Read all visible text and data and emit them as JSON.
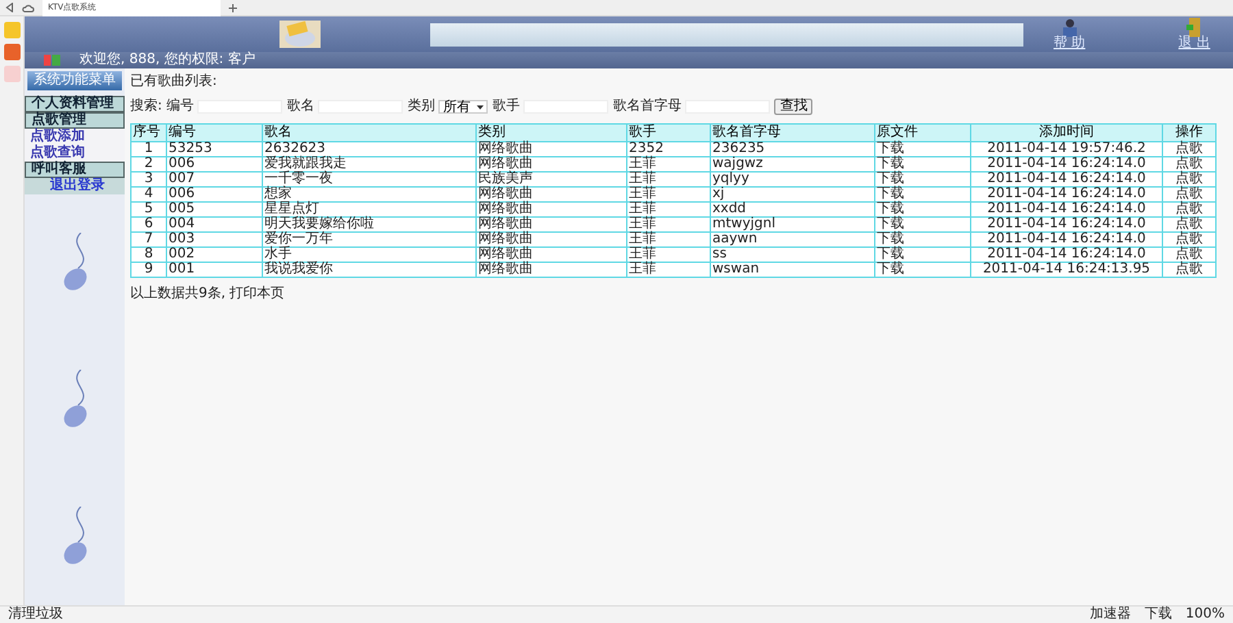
{
  "browser": {
    "tab_title": "KTV点歌系统",
    "status_left": "清理垃圾",
    "status_items": [
      "加速器",
      "下载",
      "100%"
    ]
  },
  "header": {
    "help": "帮 助",
    "exit": "退 出",
    "welcome": "欢迎您, 888, 您的权限: 客户"
  },
  "menu": {
    "title": "系统功能菜单",
    "items": [
      {
        "kind": "section",
        "label": "个人资料管理"
      },
      {
        "kind": "section",
        "label": "点歌管理"
      },
      {
        "kind": "link",
        "label": "点歌添加"
      },
      {
        "kind": "link",
        "label": "点歌查询"
      },
      {
        "kind": "section",
        "label": "呼叫客服"
      },
      {
        "kind": "logout",
        "label": "退出登录"
      }
    ]
  },
  "page_title": "已有歌曲列表:",
  "search": {
    "label": "搜索:",
    "fields": [
      "编号",
      "歌名",
      "类别",
      "歌手",
      "歌名首字母"
    ],
    "category_value": "所有",
    "button": "查找"
  },
  "table": {
    "columns": [
      "序号",
      "编号",
      "歌名",
      "类别",
      "歌手",
      "歌名首字母",
      "原文件",
      "添加时间",
      "操作"
    ],
    "rows": [
      [
        "1",
        "53253",
        "2632623",
        "网络歌曲",
        "2352",
        "236235",
        "下载",
        "2011-04-14 19:57:46.2",
        "点歌"
      ],
      [
        "2",
        "006",
        "爱我就跟我走",
        "网络歌曲",
        "王菲",
        "wajgwz",
        "下载",
        "2011-04-14 16:24:14.0",
        "点歌"
      ],
      [
        "3",
        "007",
        "一千零一夜",
        "民族美声",
        "王菲",
        "yqlyy",
        "下载",
        "2011-04-14 16:24:14.0",
        "点歌"
      ],
      [
        "4",
        "006",
        "想家",
        "网络歌曲",
        "王菲",
        "xj",
        "下载",
        "2011-04-14 16:24:14.0",
        "点歌"
      ],
      [
        "5",
        "005",
        "星星点灯",
        "网络歌曲",
        "王菲",
        "xxdd",
        "下载",
        "2011-04-14 16:24:14.0",
        "点歌"
      ],
      [
        "6",
        "004",
        "明天我要嫁给你啦",
        "网络歌曲",
        "王菲",
        "mtwyjgnl",
        "下载",
        "2011-04-14 16:24:14.0",
        "点歌"
      ],
      [
        "7",
        "003",
        "爱你一万年",
        "网络歌曲",
        "王菲",
        "aaywn",
        "下载",
        "2011-04-14 16:24:14.0",
        "点歌"
      ],
      [
        "8",
        "002",
        "水手",
        "网络歌曲",
        "王菲",
        "ss",
        "下载",
        "2011-04-14 16:24:14.0",
        "点歌"
      ],
      [
        "9",
        "001",
        "我说我爱你",
        "网络歌曲",
        "王菲",
        "wswan",
        "下载",
        "2011-04-14 16:24:13.95",
        "点歌"
      ]
    ]
  },
  "footer": "以上数据共9条, 打印本页"
}
